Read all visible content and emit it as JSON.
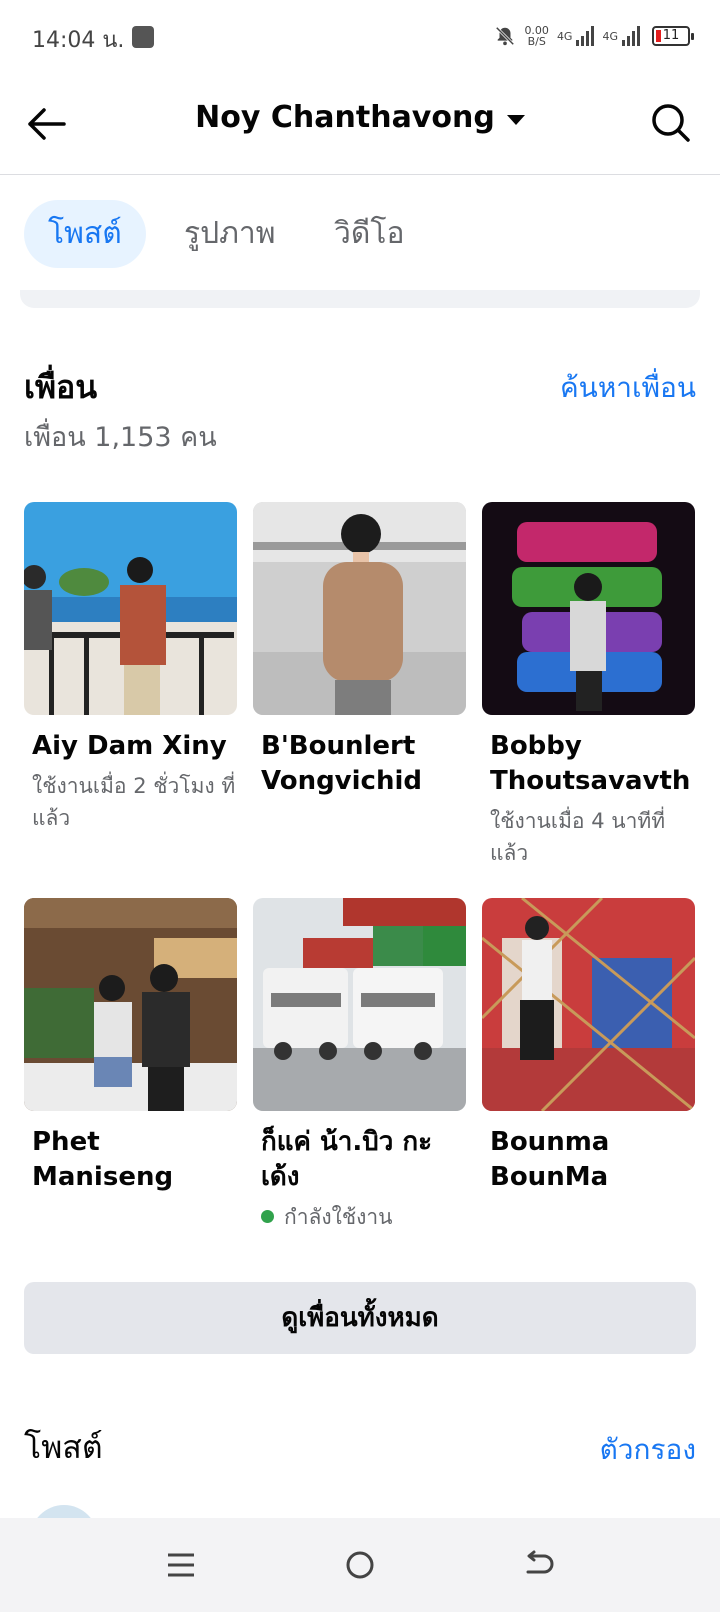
{
  "status_bar": {
    "time": "14:04 น.",
    "net_speed_value": "0.00",
    "net_speed_unit": "B/S",
    "network_1": "4G",
    "network_2": "4G",
    "battery": "11"
  },
  "header": {
    "title": "Noy Chanthavong"
  },
  "tabs": [
    {
      "label": "โพสต์",
      "active": true
    },
    {
      "label": "รูปภาพ",
      "active": false
    },
    {
      "label": "วิดีโอ",
      "active": false
    }
  ],
  "friends": {
    "title": "เพื่อน",
    "find_link": "ค้นหาเพื่อน",
    "count_label": "เพื่อน 1,153 คน",
    "items": [
      {
        "name_line1": "Aiy Dam Xiny",
        "name_line2": "",
        "status": "ใช้งานเมื่อ 2 ชั่วโมง ที่แล้ว"
      },
      {
        "name_line1": "B'Bounlert",
        "name_line2": "Vongvichid",
        "status": ""
      },
      {
        "name_line1": "Bobby",
        "name_line2": "Thoutsavavth",
        "status": "ใช้งานเมื่อ 4 นาทีที่ แล้ว"
      },
      {
        "name_line1": "Phet Maniseng",
        "name_line2": "",
        "status": ""
      },
      {
        "name_line1": "ก็แค่ น้า.บิว กะ",
        "name_line2": "เด้ง",
        "status": "กำลังใช้งาน"
      },
      {
        "name_line1": "Bounma",
        "name_line2": "BounMa",
        "status": ""
      }
    ],
    "see_all": "ดูเพื่อนทั้งหมด"
  },
  "posts_section": {
    "title": "โพสต์",
    "filter_link": "ตัวกรอง"
  },
  "colors": {
    "accent": "#1877f2",
    "tab_active_bg": "#e7f3ff",
    "secondary_text": "#65676b",
    "button_bg": "#e4e6eb",
    "online": "#31a24c"
  }
}
